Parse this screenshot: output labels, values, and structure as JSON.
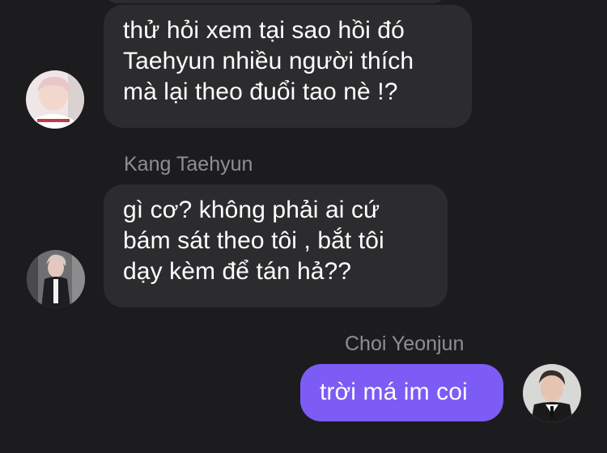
{
  "messages": [
    {
      "text": "thử hỏi xem tại sao hồi đó\nTaehyun nhiều người thích\nmà lại theo đuổi tao nè !?",
      "direction": "incoming",
      "avatar": "avatar-pink-top"
    },
    {
      "sender": "Kang Taehyun",
      "text": "gì cơ? không phải ai cứ\nbám sát theo tôi , bắt tôi\ndạy kèm để tán hả??",
      "direction": "incoming",
      "avatar": "avatar-taehyun"
    },
    {
      "sender": "Choi Yeonjun",
      "text": "trời má im coi",
      "direction": "outgoing",
      "avatar": "avatar-yeonjun"
    }
  ],
  "colors": {
    "background": "#1c1c1e",
    "incoming_bubble": "#2c2c2e",
    "outgoing_bubble": "#7c5cf5",
    "sender_name": "#8e8e93",
    "text": "#ffffff"
  }
}
